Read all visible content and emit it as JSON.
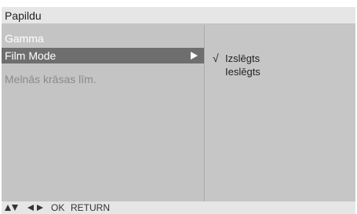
{
  "menu": {
    "title": "Papildu",
    "items": [
      {
        "label": "Gamma",
        "state": "normal"
      },
      {
        "label": "Film Mode",
        "state": "selected"
      },
      {
        "label": "Melnās krāsas līm.",
        "state": "dim"
      }
    ]
  },
  "submenu": {
    "check_mark": "√",
    "options": [
      {
        "label": "Izslēgts",
        "checked": true
      },
      {
        "label": "Ieslēgts",
        "checked": false
      }
    ]
  },
  "footer": {
    "ok_label": "OK",
    "return_label": "RETURN",
    "icons": [
      "up-arrow-icon",
      "down-arrow-icon",
      "left-arrow-icon",
      "right-arrow-icon"
    ]
  },
  "colors": {
    "selected_background": "#6e6e6e",
    "panel_background": "#c4c4c4",
    "title_background": "#e6e6e6"
  }
}
